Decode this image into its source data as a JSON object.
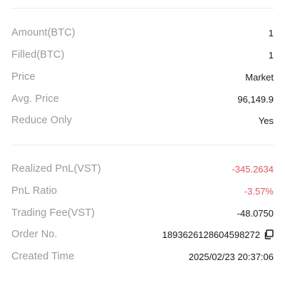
{
  "order": {
    "amount": {
      "label": "Amount(BTC)",
      "value": "1"
    },
    "filled": {
      "label": "Filled(BTC)",
      "value": "1"
    },
    "price": {
      "label": "Price",
      "value": "Market"
    },
    "avg_price": {
      "label": "Avg. Price",
      "value": "96,149.9"
    },
    "reduce_only": {
      "label": "Reduce Only",
      "value": "Yes"
    }
  },
  "pnl": {
    "realized": {
      "label": "Realized PnL(VST)",
      "value": "-345.2634"
    },
    "ratio": {
      "label": "PnL Ratio",
      "value": "-3.57%"
    },
    "fee": {
      "label": "Trading Fee(VST)",
      "value": "-48.0750"
    },
    "order_no": {
      "label": "Order No.",
      "value": "1893626128604598272"
    },
    "created": {
      "label": "Created Time",
      "value": "2025/02/23 20:37:06"
    }
  },
  "icons": {
    "copy": "copy-icon"
  },
  "colors": {
    "negative": "#e0565f",
    "label": "#9a9a9a",
    "value": "#1a1a1a"
  }
}
